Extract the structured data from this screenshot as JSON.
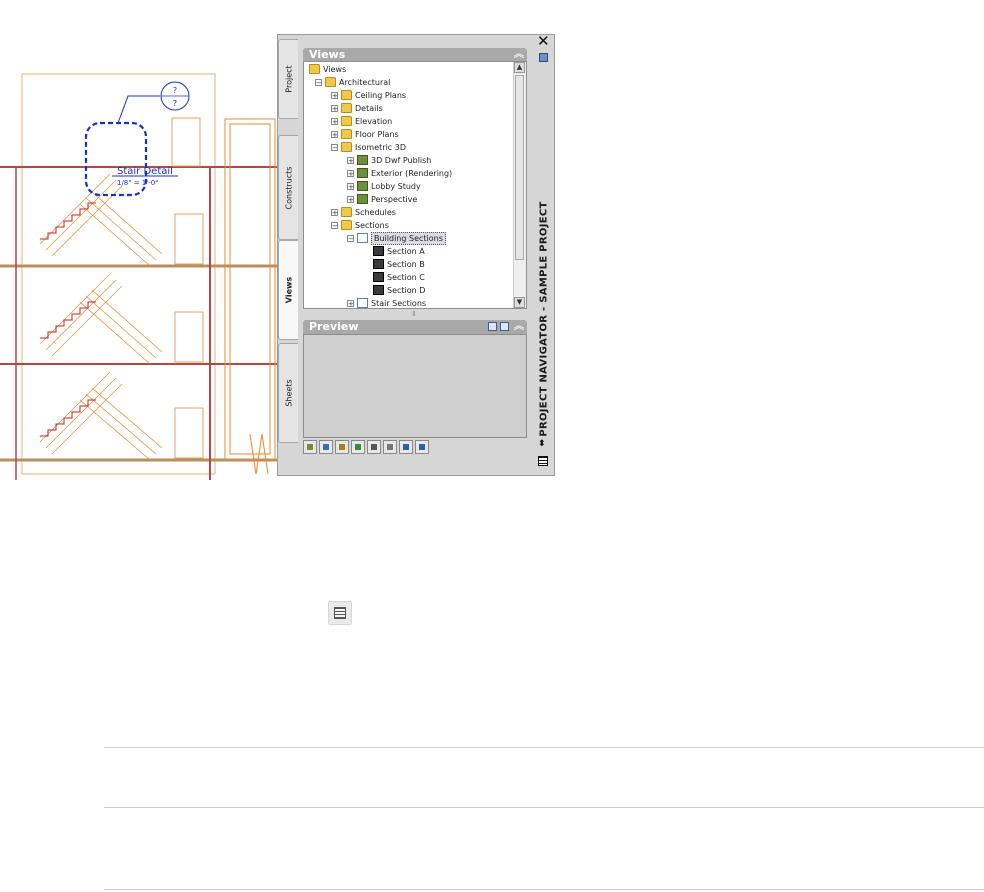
{
  "drawing": {
    "tag_top": "?",
    "tag_bottom": "?",
    "callout_title": "Stair Detail",
    "callout_scale": "1/8\" = 1'-0\""
  },
  "palette": {
    "tabs": [
      {
        "label": "Project",
        "active": false
      },
      {
        "label": "Constructs",
        "active": false
      },
      {
        "label": "Views",
        "active": true
      },
      {
        "label": "Sheets",
        "active": false
      }
    ],
    "views_header": "Views",
    "preview_header": "Preview",
    "vertical_title": "PROJECT NAVIGATOR - SAMPLE PROJECT",
    "tree": [
      {
        "label": "Views",
        "level": 0,
        "icon": "folder-icon",
        "toggle": ""
      },
      {
        "label": "Architectural",
        "level": 1,
        "icon": "folder-icon",
        "toggle": "−"
      },
      {
        "label": "Ceiling Plans",
        "level": 2,
        "icon": "folder-icon",
        "toggle": "+"
      },
      {
        "label": "Details",
        "level": 2,
        "icon": "folder-icon",
        "toggle": "+"
      },
      {
        "label": "Elevation",
        "level": 2,
        "icon": "folder-icon",
        "toggle": "+"
      },
      {
        "label": "Floor Plans",
        "level": 2,
        "icon": "folder-icon",
        "toggle": "+"
      },
      {
        "label": "Isometric 3D",
        "level": 2,
        "icon": "folder-icon",
        "toggle": "−"
      },
      {
        "label": "3D Dwf Publish",
        "level": 3,
        "icon": "view-3d-icon",
        "toggle": "+"
      },
      {
        "label": "Exterior (Rendering)",
        "level": 3,
        "icon": "view-3d-icon",
        "toggle": "+"
      },
      {
        "label": "Lobby Study",
        "level": 3,
        "icon": "view-3d-icon",
        "toggle": "+"
      },
      {
        "label": "Perspective",
        "level": 3,
        "icon": "view-3d-icon",
        "toggle": "+"
      },
      {
        "label": "Schedules",
        "level": 2,
        "icon": "folder-icon",
        "toggle": "+"
      },
      {
        "label": "Sections",
        "level": 2,
        "icon": "folder-icon",
        "toggle": "−"
      },
      {
        "label": "Building Sections",
        "level": 3,
        "icon": "building-section-icon",
        "toggle": "−",
        "selected": true
      },
      {
        "label": "Section A",
        "level": 4,
        "icon": "section-view-icon",
        "toggle": ""
      },
      {
        "label": "Section B",
        "level": 4,
        "icon": "section-view-icon",
        "toggle": ""
      },
      {
        "label": "Section C",
        "level": 4,
        "icon": "section-view-icon",
        "toggle": ""
      },
      {
        "label": "Section D",
        "level": 4,
        "icon": "section-view-icon",
        "toggle": ""
      },
      {
        "label": "Stair Sections",
        "level": 3,
        "icon": "building-section-icon",
        "toggle": "+"
      }
    ],
    "toolbar_icons": [
      "add-view-icon",
      "add-detail-view-icon",
      "add-model-view-icon",
      "regenerate-icon",
      "repath-project-icon",
      "view-properties-icon",
      "refresh-icon",
      "sheet-set-icon"
    ]
  },
  "colors": {
    "drawing_lines": "#e8892e",
    "stair_red": "#cc1f1f",
    "callout_blue": "#1b2fcc",
    "tag_blue": "#1b2fcc"
  }
}
